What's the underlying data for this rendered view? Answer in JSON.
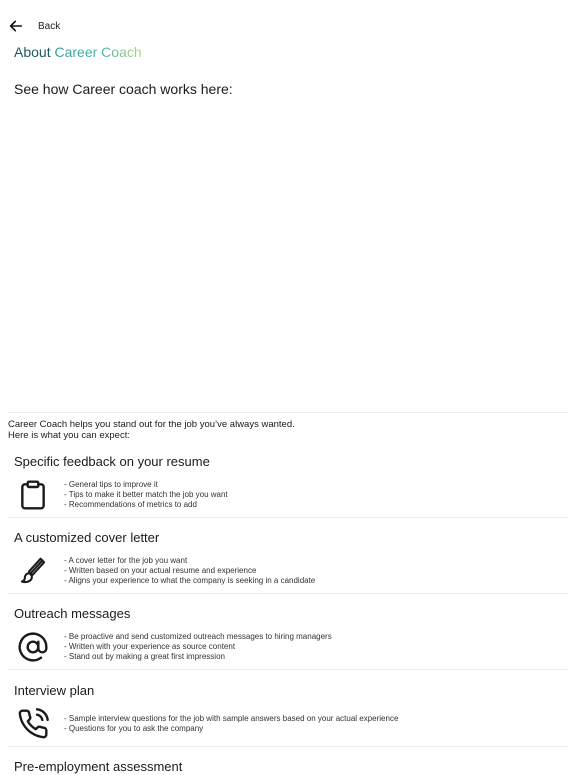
{
  "nav": {
    "back_label": "Back"
  },
  "header": {
    "title_prefix": "About ",
    "title_brand": "Career Coach"
  },
  "video_section": {
    "heading": "See how Career coach works here:"
  },
  "intro": {
    "line1": "Career Coach helps you stand out for the job you’ve always wanted.",
    "line2": "Here is what you can expect:"
  },
  "features": [
    {
      "title": "Specific feedback on your resume",
      "icon": "clipboard-icon",
      "bullets": [
        "- General tips to improve it",
        "- Tips to make it better match the job you want",
        "- Recommendations of metrics to add"
      ]
    },
    {
      "title": "A customized cover letter",
      "icon": "paintbrush-icon",
      "bullets": [
        "- A cover letter for the job you want",
        "- Written based on your actual resume and experience",
        "- Aligns your experience to what the company is seeking in a candidate"
      ]
    },
    {
      "title": "Outreach messages",
      "icon": "at-sign-icon",
      "bullets": [
        "- Be proactive and send customized outreach messages to hiring managers",
        "- Written with your experience as source content",
        "- Stand out by making a great first impression"
      ]
    },
    {
      "title": "Interview plan",
      "icon": "phone-call-icon",
      "bullets": [
        "- Sample interview questions for the job with sample answers based on your actual experience",
        "- Questions for you to ask the company"
      ]
    },
    {
      "title": "Pre-employment assessment",
      "icon": "",
      "bullets": []
    }
  ],
  "colors": {
    "brand_start": "#2f9e94",
    "brand_end": "#b9cf86",
    "title_plain": "#1f5a63"
  }
}
